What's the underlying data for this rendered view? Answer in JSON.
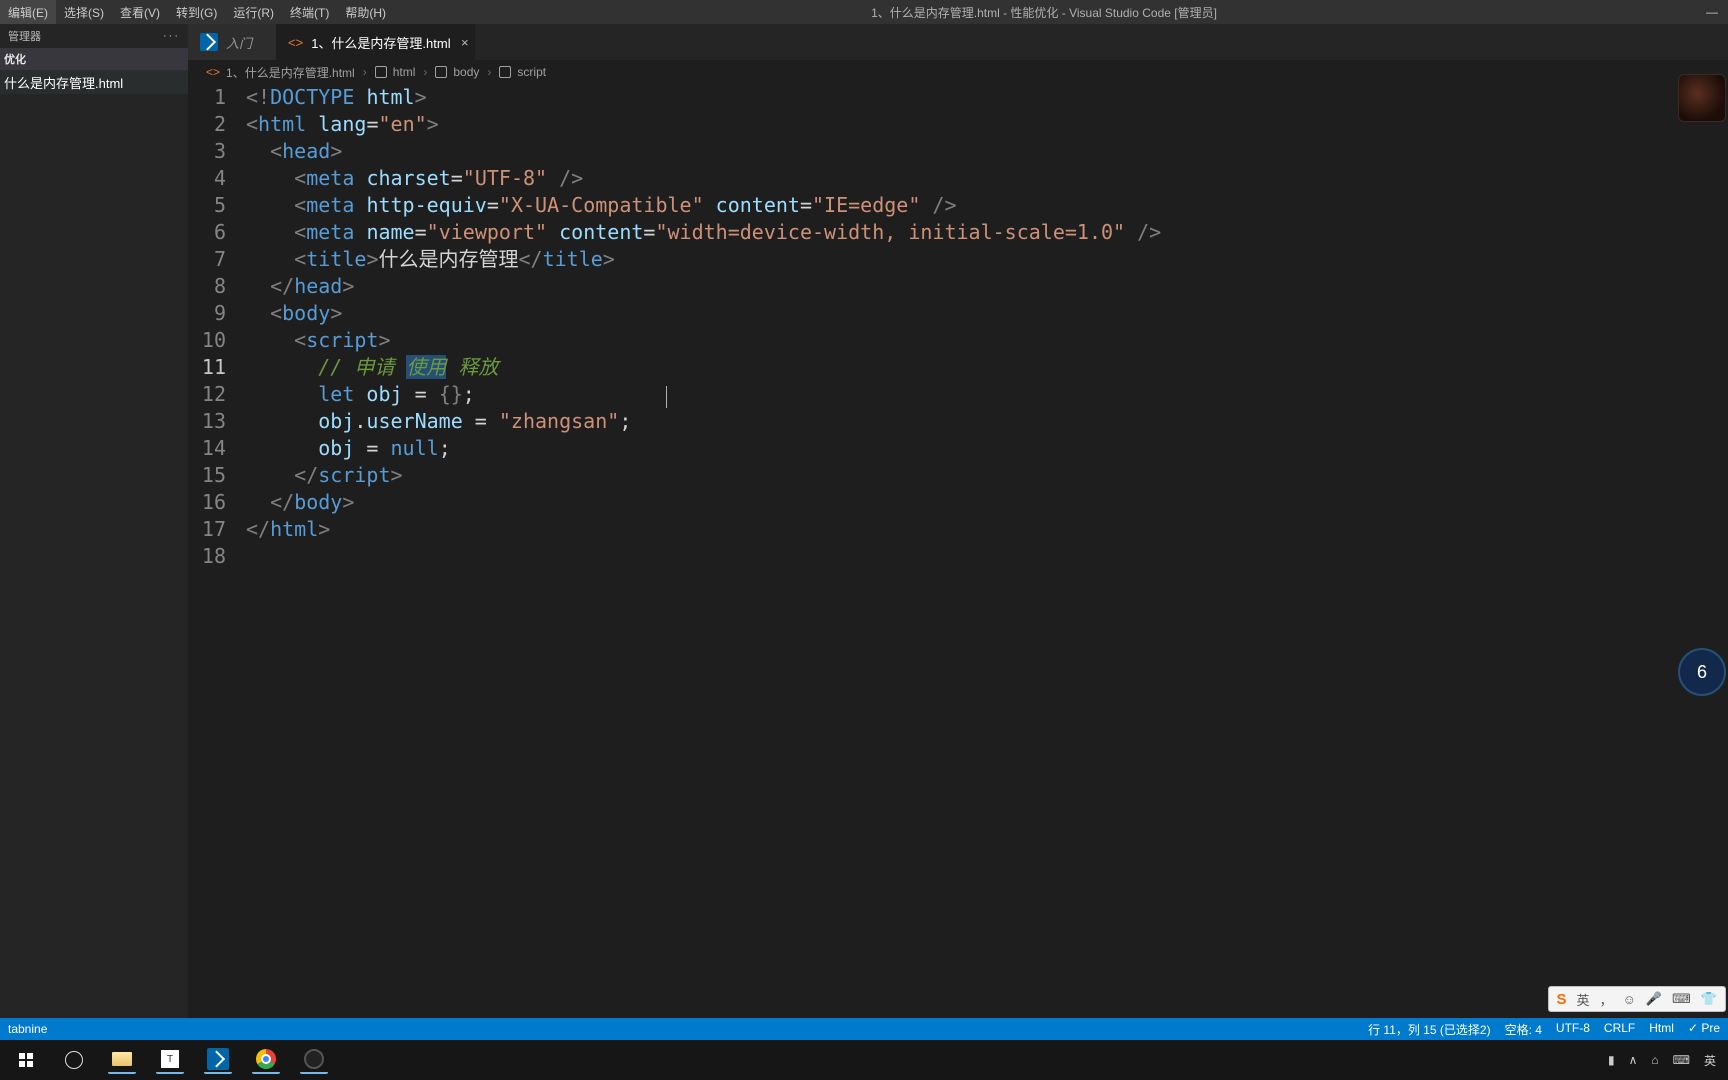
{
  "menu": {
    "edit": "编辑(E)",
    "select": "选择(S)",
    "view": "查看(V)",
    "go": "转到(G)",
    "run": "运行(R)",
    "terminal": "终端(T)",
    "help": "帮助(H)"
  },
  "window_title": "1、什么是内存管理.html - 性能优化 - Visual Studio Code [管理员]",
  "explorer": {
    "header": "管理器",
    "actions": "···",
    "section": "优化",
    "file": "什么是内存管理.html"
  },
  "tabs": {
    "welcome_label": "入门",
    "file_label": "1、什么是内存管理.html"
  },
  "breadcrumbs": {
    "file": "1、什么是内存管理.html",
    "b1": "html",
    "b2": "body",
    "b3": "script"
  },
  "code": {
    "comment_a": "// 申请",
    "comment_sel": "使用",
    "comment_b": " 释放",
    "title_text": "什么是内存管理"
  },
  "zoom_value": "6",
  "statusbar": {
    "tabnine": "tabnine",
    "pos": "行 11，列 15 (已选择2)",
    "spaces": "空格: 4",
    "encoding": "UTF-8",
    "eol": "CRLF",
    "lang": "Html",
    "prettier": "✓ Pre"
  },
  "ime": {
    "brand": "S",
    "lang": "英",
    "comma": "，",
    "smile": "☺",
    "mic": "🎤",
    "kbd": "⌨",
    "t": "👕"
  },
  "tray": {
    "battery": "▮",
    "up": "∧",
    "cloud": "⌂",
    "kbd": "⌨",
    "ime": "英"
  },
  "l": [
    "1",
    "2",
    "3",
    "4",
    "5",
    "6",
    "7",
    "8",
    "9",
    "10",
    "11",
    "12",
    "13",
    "14",
    "15",
    "16",
    "17",
    "18"
  ]
}
